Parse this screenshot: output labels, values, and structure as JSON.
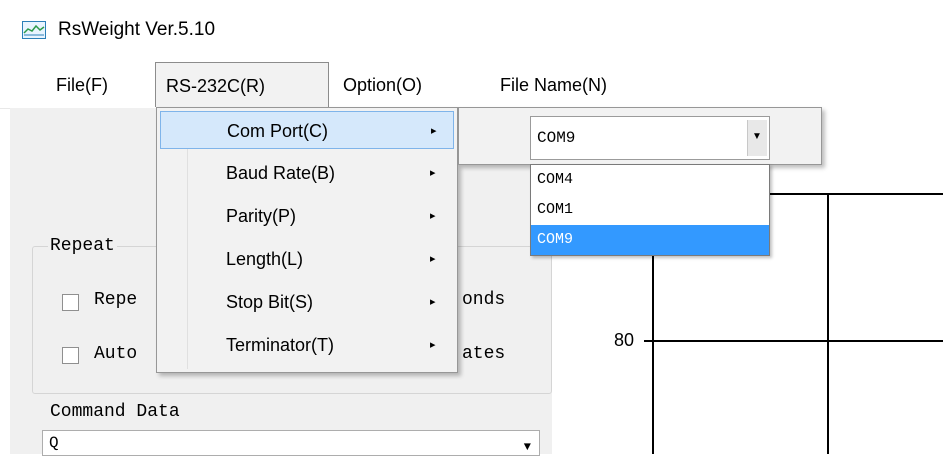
{
  "window": {
    "title": "RsWeight Ver.5.10",
    "icon": "chart-window-icon"
  },
  "menubar": [
    {
      "label": "File(F)"
    },
    {
      "label": "RS-232C(R)"
    },
    {
      "label": "Option(O)"
    },
    {
      "label": "File Name(N)"
    }
  ],
  "rs232_menu": {
    "items": [
      {
        "label": "Com Port(C)"
      },
      {
        "label": "Baud Rate(B)"
      },
      {
        "label": "Parity(P)"
      },
      {
        "label": "Length(L)"
      },
      {
        "label": "Stop Bit(S)"
      },
      {
        "label": "Terminator(T)"
      }
    ],
    "arrow_glyph": "▸"
  },
  "com_port": {
    "selected": "COM9",
    "options": [
      "COM4",
      "COM1",
      "COM9"
    ],
    "highlighted": "COM9",
    "dropdown_glyph": "▼"
  },
  "left_panel": {
    "group_label": "Repeat",
    "row1_start": "Repe",
    "row1_end": "onds",
    "row2_start": "Auto",
    "row2_end": "ates",
    "command_label": "Command Data",
    "command_value": "Q",
    "command_glyph": "▼"
  },
  "chart": {
    "y_tick": "80"
  },
  "colors": {
    "highlight": "#3399ff",
    "menu_highlight": "#d5e8fb"
  }
}
